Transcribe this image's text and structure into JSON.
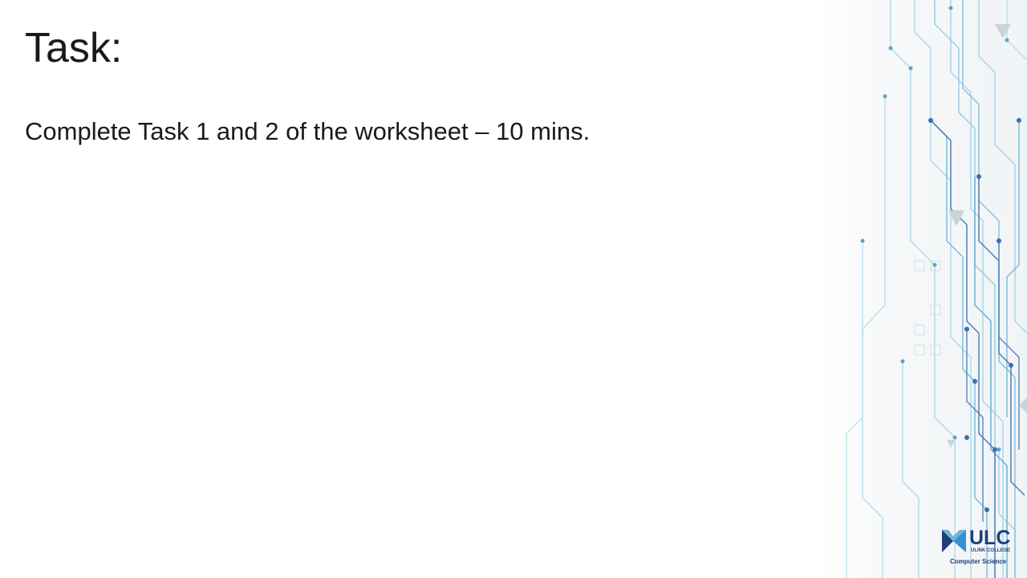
{
  "slide": {
    "title": "Task:",
    "body": "Complete Task 1 and 2 of the worksheet – 10 mins."
  },
  "logo": {
    "name": "ULC",
    "subtitle": "ULINK COLLEGE",
    "department": "Computer Science"
  },
  "colors": {
    "text": "#1a1a1a",
    "circuit_light": "#a9d9e8",
    "circuit_mid": "#6fb6d6",
    "circuit_dark": "#3a6fb0",
    "logo": "#1f3f7a"
  }
}
